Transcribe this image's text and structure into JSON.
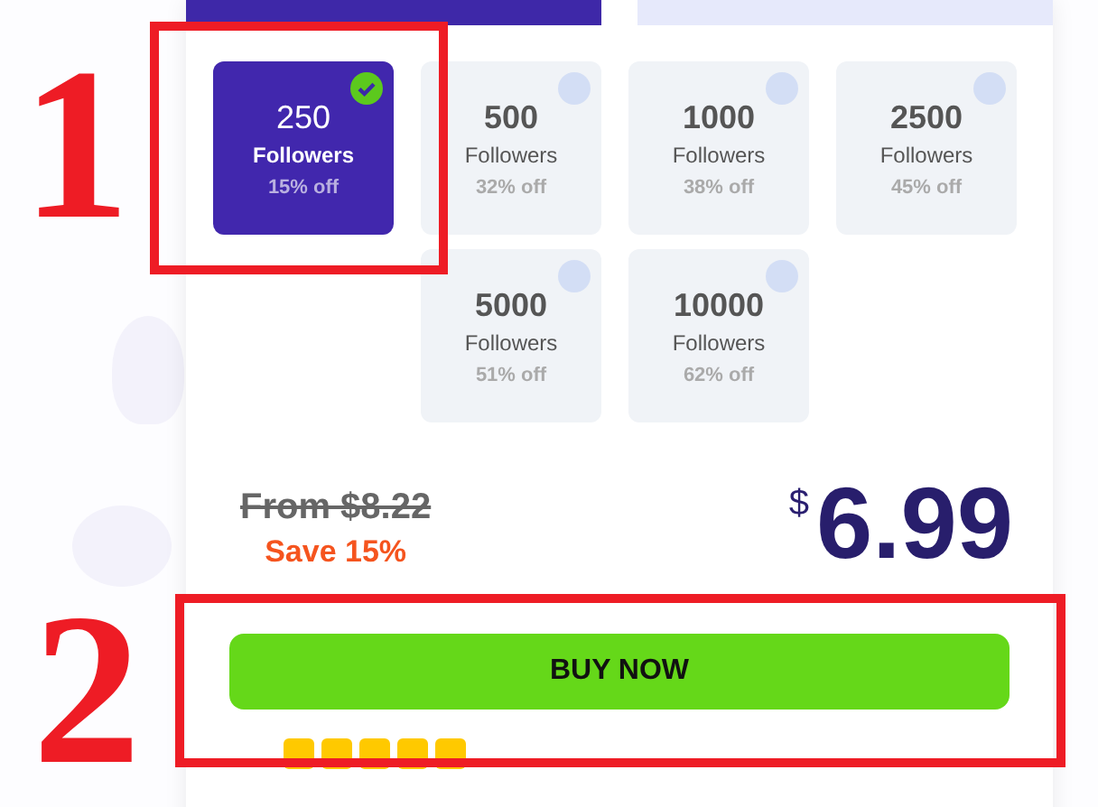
{
  "tabs": [
    {
      "selected": true
    },
    {
      "selected": false
    }
  ],
  "packages": [
    {
      "amount": "250",
      "unit": "Followers",
      "discount": "15% off",
      "selected": true
    },
    {
      "amount": "500",
      "unit": "Followers",
      "discount": "32% off",
      "selected": false
    },
    {
      "amount": "1000",
      "unit": "Followers",
      "discount": "38% off",
      "selected": false
    },
    {
      "amount": "2500",
      "unit": "Followers",
      "discount": "45% off",
      "selected": false
    },
    {
      "amount": "5000",
      "unit": "Followers",
      "discount": "51% off",
      "selected": false
    },
    {
      "amount": "10000",
      "unit": "Followers",
      "discount": "62% off",
      "selected": false
    }
  ],
  "price": {
    "old_price": "From $8.22",
    "savings": "Save 15%",
    "currency": "$",
    "amount": "6.99"
  },
  "buy_button": "BUY NOW",
  "rating": {
    "stars": 5
  },
  "annotations": [
    {
      "number": "1"
    },
    {
      "number": "2"
    }
  ]
}
